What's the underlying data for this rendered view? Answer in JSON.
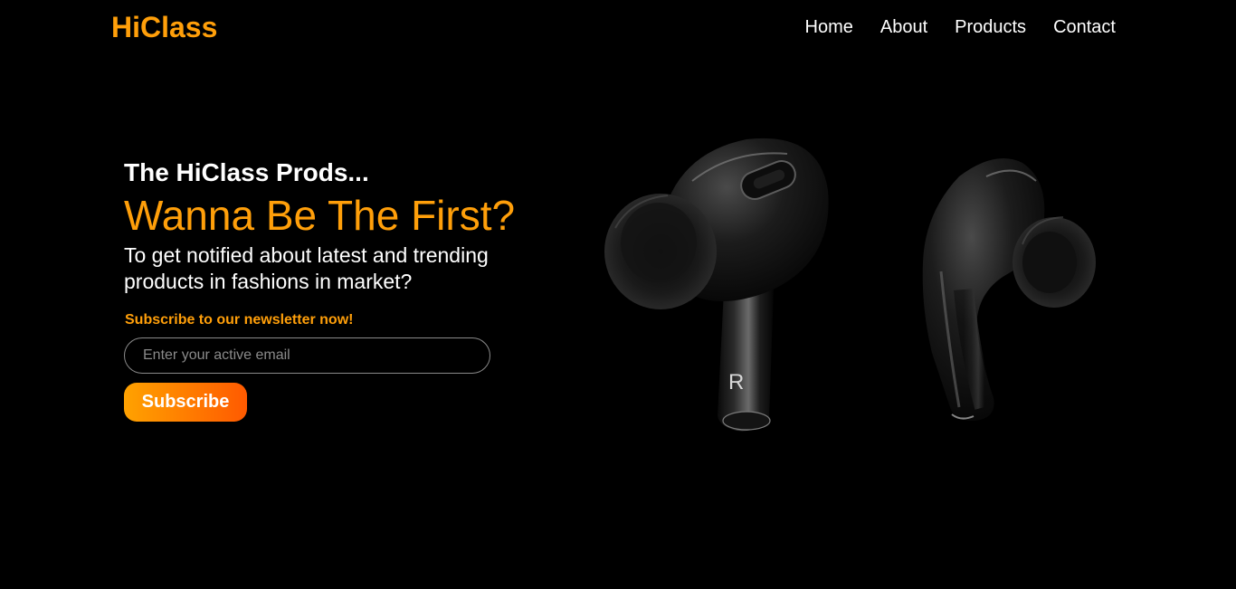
{
  "brand": {
    "name": "HiClass",
    "accent_color": "#ff9f0a"
  },
  "nav": {
    "items": [
      {
        "label": "Home"
      },
      {
        "label": "About"
      },
      {
        "label": "Products"
      },
      {
        "label": "Contact"
      }
    ]
  },
  "hero": {
    "subtitle": "The HiClass Prods...",
    "headline": "Wanna Be The First?",
    "description": "To get notified about latest and trending products in fashions in market?",
    "newsletter_label": "Subscribe to our newsletter now!",
    "email_placeholder": "Enter your active email",
    "subscribe_label": "Subscribe"
  },
  "product_image": {
    "right_bud_letter": "R"
  }
}
